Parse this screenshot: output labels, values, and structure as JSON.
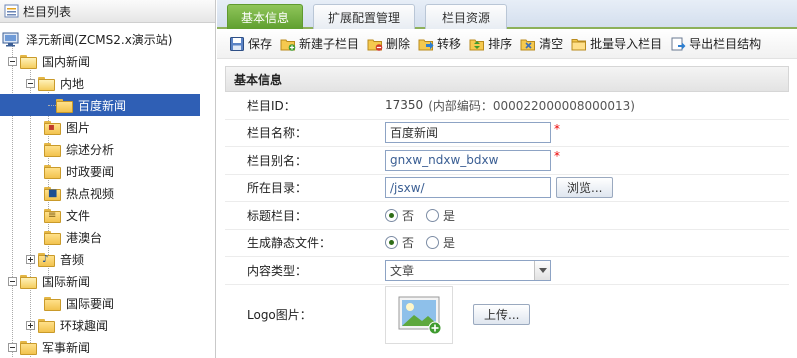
{
  "left_panel": {
    "title": "栏目列表",
    "tree": [
      {
        "label": "泽元新闻(ZCMS2.x演示站)",
        "level": 0,
        "toggle": "minus",
        "icon": "site-icon"
      },
      {
        "label": "国内新闻",
        "level": 1,
        "toggle": "minus",
        "icon": "folder-open-icon"
      },
      {
        "label": "内地",
        "level": 2,
        "toggle": "minus",
        "icon": "folder-open-icon"
      },
      {
        "label": "百度新闻",
        "level": 3,
        "toggle": "none",
        "icon": "folder-icon",
        "selected": true
      },
      {
        "label": "图片",
        "level": 2,
        "toggle": "none",
        "icon": "image-folder-icon"
      },
      {
        "label": "综述分析",
        "level": 2,
        "toggle": "none",
        "icon": "folder-icon"
      },
      {
        "label": "时政要闻",
        "level": 2,
        "toggle": "none",
        "icon": "folder-icon"
      },
      {
        "label": "热点视频",
        "level": 2,
        "toggle": "none",
        "icon": "video-folder-icon"
      },
      {
        "label": "文件",
        "level": 2,
        "toggle": "none",
        "icon": "file-folder-icon"
      },
      {
        "label": "港澳台",
        "level": 2,
        "toggle": "none",
        "icon": "folder-icon"
      },
      {
        "label": "音频",
        "level": 2,
        "toggle": "plus",
        "icon": "audio-folder-icon"
      },
      {
        "label": "国际新闻",
        "level": 1,
        "toggle": "minus",
        "icon": "folder-open-icon"
      },
      {
        "label": "国际要闻",
        "level": 2,
        "toggle": "none",
        "icon": "folder-icon"
      },
      {
        "label": "环球趣闻",
        "level": 2,
        "toggle": "plus",
        "icon": "folder-icon"
      },
      {
        "label": "军事新闻",
        "level": 1,
        "toggle": "minus",
        "icon": "folder-icon"
      }
    ]
  },
  "tabs": [
    {
      "label": "基本信息",
      "active": true
    },
    {
      "label": "扩展配置管理",
      "active": false
    },
    {
      "label": "栏目资源",
      "active": false
    }
  ],
  "toolbar": {
    "save": "保存",
    "new_child": "新建子栏目",
    "delete": "删除",
    "move": "转移",
    "sort": "排序",
    "clear": "清空",
    "batch_import": "批量导入栏目",
    "export": "导出栏目结构"
  },
  "form": {
    "section_title": "基本信息",
    "id_label": "栏目ID：",
    "id_value": "17350",
    "inner_code": "(内部编码：000022000008000013)",
    "name_label": "栏目名称：",
    "name_value": "百度新闻",
    "alias_label": "栏目别名：",
    "alias_value": "gnxw_ndxw_bdxw",
    "dir_label": "所在目录：",
    "dir_value": "/jsxw/",
    "browse_btn": "浏览...",
    "title_col_label": "标题栏目：",
    "static_label": "生成静态文件：",
    "opt_no": "否",
    "opt_yes": "是",
    "title_col_selected": "否",
    "static_selected": "否",
    "content_type_label": "内容类型：",
    "content_type_value": "文章",
    "logo_label": "Logo图片：",
    "upload_btn": "上传...",
    "required_mark": "*"
  },
  "colors": {
    "tab_active": "#6fad3c",
    "selection": "#2f5fb5",
    "required": "#e00000"
  }
}
